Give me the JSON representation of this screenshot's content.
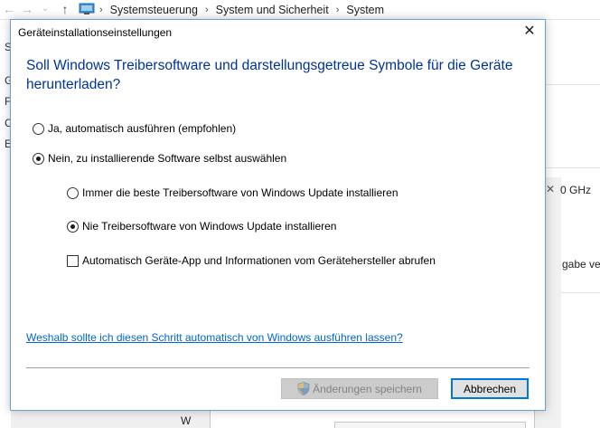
{
  "explorer": {
    "breadcrumb": [
      "Systemsteuerung",
      "System und Sicherheit",
      "System"
    ],
    "left_letters": [
      "S",
      "G",
      "F",
      "C",
      "E"
    ],
    "right_texts": {
      "ghz": "0 GHz",
      "gabe": "gabe verf"
    },
    "bottom_letter": "W"
  },
  "dialog": {
    "title": "Geräteinstallationseinstellungen",
    "heading": "Soll Windows Treibersoftware und darstellungsgetreue Symbole für die Geräte herunterladen?",
    "options": {
      "yes_auto": {
        "label": "Ja, automatisch ausführen (empfohlen)",
        "selected": false
      },
      "no_choose": {
        "label": "Nein, zu installierende Software selbst auswählen",
        "selected": true
      },
      "always_best": {
        "label": "Immer die beste Treibersoftware von Windows Update installieren",
        "selected": false
      },
      "never_install": {
        "label": "Nie Treibersoftware von Windows Update installieren",
        "selected": true
      },
      "auto_app": {
        "label": "Automatisch Geräte-App und Informationen vom Gerätehersteller abrufen",
        "checked": false
      }
    },
    "why_link": "Weshalb sollte ich diesen Schritt automatisch von Windows ausführen lassen?",
    "save_button": "Änderungen speichern",
    "cancel_button": "Abbrechen"
  },
  "colors": {
    "heading": "#003399",
    "link": "#0066cc",
    "focus_border": "#0078d7"
  }
}
